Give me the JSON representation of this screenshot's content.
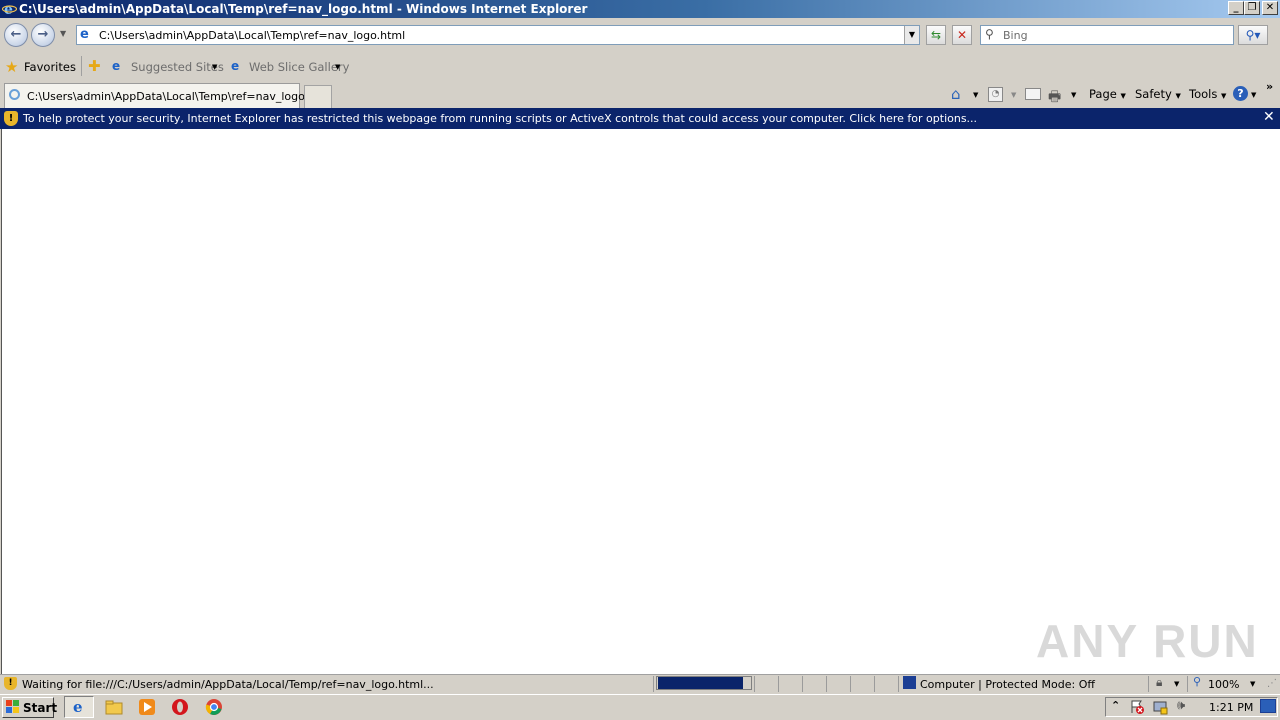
{
  "window": {
    "title": "C:\\Users\\admin\\AppData\\Local\\Temp\\ref=nav_logo.html - Windows Internet Explorer",
    "controls": [
      "minimize",
      "restore",
      "close"
    ]
  },
  "nav": {
    "address_value": "C:\\Users\\admin\\AppData\\Local\\Temp\\ref=nav_logo.html",
    "search_placeholder": "Bing"
  },
  "favorites_bar": {
    "favorites_label": "Favorites",
    "items": [
      {
        "label": "Suggested Sites"
      },
      {
        "label": "Web Slice Gallery"
      }
    ]
  },
  "tabs": [
    {
      "label": "C:\\Users\\admin\\AppData\\Local\\Temp\\ref=nav_logo.h..."
    }
  ],
  "command_bar": {
    "page": "Page",
    "safety": "Safety",
    "tools": "Tools"
  },
  "info_bar": {
    "message": "To help protect your security, Internet Explorer has restricted this webpage from running scripts or ActiveX controls that could access your computer. Click here for options..."
  },
  "status_bar": {
    "text": "Waiting for file:///C:/Users/admin/AppData/Local/Temp/ref=nav_logo.html...",
    "zone": "Computer | Protected Mode: Off",
    "zoom": "100%",
    "progress": 0.9
  },
  "taskbar": {
    "start_label": "Start",
    "clock": "1:21 PM"
  },
  "watermark": "ANY RUN",
  "colors": {
    "infobar_bg": "#0b246b",
    "titlebar_start": "#0a246a",
    "progress_fill": "#0a246a"
  }
}
